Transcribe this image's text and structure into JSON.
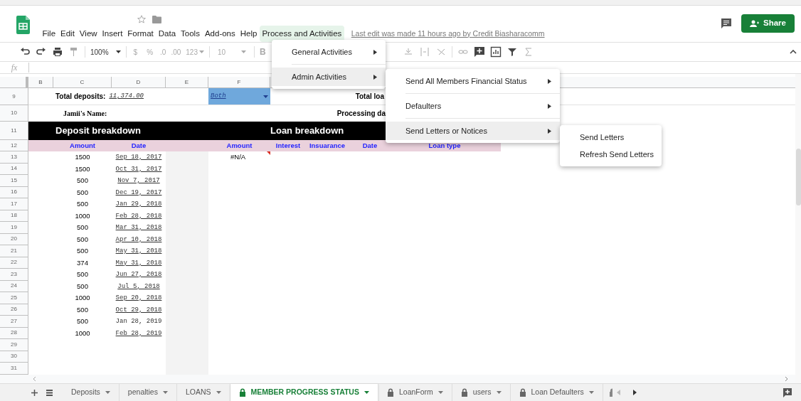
{
  "menubar": [
    {
      "label": "File",
      "selected": false
    },
    {
      "label": "Edit",
      "selected": false
    },
    {
      "label": "View",
      "selected": false
    },
    {
      "label": "Insert",
      "selected": false
    },
    {
      "label": "Format",
      "selected": false
    },
    {
      "label": "Data",
      "selected": false
    },
    {
      "label": "Tools",
      "selected": false
    },
    {
      "label": "Add-ons",
      "selected": false
    },
    {
      "label": "Help",
      "selected": false
    },
    {
      "label": "Process and Activities",
      "selected": true
    }
  ],
  "last_edit": "Last edit was made 11 hours ago by Credit Biasharacomm",
  "share": "Share",
  "toolbar": {
    "zoom": "100%",
    "currency": "$",
    "percent": "%",
    "decrease_decimals": ".0",
    "increase_decimals": ".00",
    "format": "123",
    "font_size": "10",
    "bold": "B"
  },
  "formula_label": "fx",
  "columns": [
    "B",
    "C",
    "D",
    "E",
    "F"
  ],
  "sheet": {
    "total_deposits_label": "Total deposits:",
    "total_deposits": "11,374.00",
    "filter_value": "Both",
    "total_loans_label": "Total loa",
    "name_label": "Jamii's Name:",
    "processing_label": "Processing da",
    "deposit_title": "Deposit breakdown",
    "loan_title": "Loan breakdown",
    "deposit_headers": [
      "Amount",
      "Date"
    ],
    "loan_headers": [
      "Amount",
      "Interest",
      "Insuarance",
      "Date",
      "Loan type"
    ],
    "loan_amount": "#N/A",
    "header_row_numbers": [
      "9",
      "10",
      "11",
      "12"
    ],
    "rows": [
      {
        "row": "13",
        "amount": "1500",
        "date": "Sep 18, 2017",
        "linked": true
      },
      {
        "row": "14",
        "amount": "1500",
        "date": "Oct 31, 2017",
        "linked": true
      },
      {
        "row": "15",
        "amount": "500",
        "date": "Nov 7, 2017",
        "linked": true
      },
      {
        "row": "16",
        "amount": "500",
        "date": "Dec 19, 2017",
        "linked": true
      },
      {
        "row": "17",
        "amount": "500",
        "date": "Jan 29, 2018",
        "linked": true
      },
      {
        "row": "18",
        "amount": "1000",
        "date": "Feb 28, 2018",
        "linked": true
      },
      {
        "row": "19",
        "amount": "500",
        "date": "Mar 31, 2018",
        "linked": true
      },
      {
        "row": "20",
        "amount": "500",
        "date": "Apr 10, 2018",
        "linked": true
      },
      {
        "row": "21",
        "amount": "500",
        "date": "May 31, 2018",
        "linked": true
      },
      {
        "row": "22",
        "amount": "374",
        "date": "May 31, 2018",
        "linked": true
      },
      {
        "row": "23",
        "amount": "500",
        "date": "Jun 27, 2018",
        "linked": true
      },
      {
        "row": "24",
        "amount": "500",
        "date": "Jul 5, 2018",
        "linked": true
      },
      {
        "row": "25",
        "amount": "1000",
        "date": "Sep 20, 2018",
        "linked": true
      },
      {
        "row": "26",
        "amount": "500",
        "date": "Oct 29, 2018",
        "linked": true
      },
      {
        "row": "27",
        "amount": "500",
        "date": "Jan 28, 2019",
        "linked": false
      },
      {
        "row": "28",
        "amount": "1000",
        "date": "Feb 28, 2019",
        "linked": true
      }
    ],
    "empty_rows": [
      "29",
      "30",
      "31"
    ]
  },
  "menu": [
    {
      "label": "General Activities",
      "selected": false,
      "has_submenu": true
    },
    {
      "label": "Admin Activities",
      "selected": true,
      "has_submenu": true,
      "children": [
        {
          "label": "Send All Members Financial Status",
          "selected": false,
          "has_submenu": true
        },
        {
          "label": "Defaulters",
          "selected": false,
          "has_submenu": true
        },
        {
          "label": "Send Letters or Notices",
          "selected": true,
          "has_submenu": true,
          "children": [
            {
              "label": "Send Letters",
              "selected": false,
              "has_submenu": false
            },
            {
              "label": "Refresh Send Letters",
              "selected": false,
              "has_submenu": false
            }
          ]
        }
      ]
    }
  ],
  "sheet_tabs": [
    {
      "label": "Deposits",
      "selected": false,
      "locked": false
    },
    {
      "label": "penalties",
      "selected": false,
      "locked": false
    },
    {
      "label": "LOANS",
      "selected": false,
      "locked": false
    },
    {
      "label": "MEMBER PROGRESS STATUS",
      "selected": true,
      "locked": true
    },
    {
      "label": "LoanForm",
      "selected": false,
      "locked": true
    },
    {
      "label": "users",
      "selected": false,
      "locked": true
    },
    {
      "label": "Loan Defaulters",
      "selected": false,
      "locked": true
    }
  ]
}
